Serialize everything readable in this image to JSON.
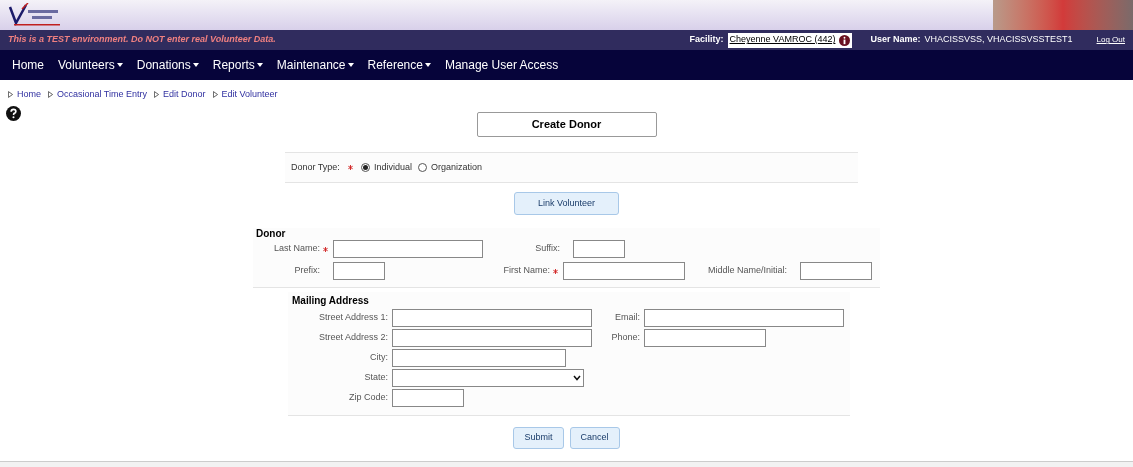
{
  "header": {
    "warning": "This is a TEST environment. Do NOT enter real Volunteer Data.",
    "facility_label": "Facility:",
    "facility_value": "Cheyenne VAMROC (442)",
    "user_label": "User Name:",
    "user_value": "VHACISSVSS, VHACISSVSSTEST1",
    "logout": "Log Out"
  },
  "nav": [
    {
      "label": "Home",
      "dropdown": false
    },
    {
      "label": "Volunteers",
      "dropdown": true
    },
    {
      "label": "Donations",
      "dropdown": true
    },
    {
      "label": "Reports",
      "dropdown": true
    },
    {
      "label": "Maintenance",
      "dropdown": true
    },
    {
      "label": "Reference",
      "dropdown": true
    },
    {
      "label": "Manage User Access",
      "dropdown": false
    }
  ],
  "breadcrumbs": [
    "Home",
    "Occasional Time Entry",
    "Edit Donor",
    "Edit Volunteer"
  ],
  "title_button": "Create Donor",
  "donor_type": {
    "label": "Donor Type:",
    "required": true,
    "options": [
      {
        "label": "Individual",
        "selected": true
      },
      {
        "label": "Organization",
        "selected": false
      }
    ]
  },
  "link_button": "Link Volunteer",
  "donor": {
    "title": "Donor",
    "rows": [
      [
        {
          "label": "Last Name:",
          "required": true,
          "kind": "input"
        },
        {
          "label": "Suffix:",
          "required": false,
          "kind": "input"
        }
      ],
      [
        {
          "label": "Prefix:",
          "required": false,
          "kind": "input"
        },
        {
          "label": "First Name:",
          "required": true,
          "kind": "input"
        },
        {
          "label": "Middle Name/Initial:",
          "required": false,
          "kind": "input"
        }
      ]
    ]
  },
  "mailing": {
    "title": "Mailing Address",
    "rows": [
      [
        {
          "label": "Street Address 1:",
          "kind": "input"
        },
        {
          "label": "Email:",
          "kind": "input"
        }
      ],
      [
        {
          "label": "Street Address 2:",
          "kind": "input"
        },
        {
          "label": "Phone:",
          "kind": "input"
        }
      ],
      [
        {
          "label": "City:",
          "kind": "input"
        }
      ],
      [
        {
          "label": "State:",
          "kind": "select"
        }
      ],
      [
        {
          "label": "Zip Code:",
          "kind": "input"
        }
      ]
    ]
  },
  "buttons": [
    "Submit",
    "Cancel"
  ]
}
